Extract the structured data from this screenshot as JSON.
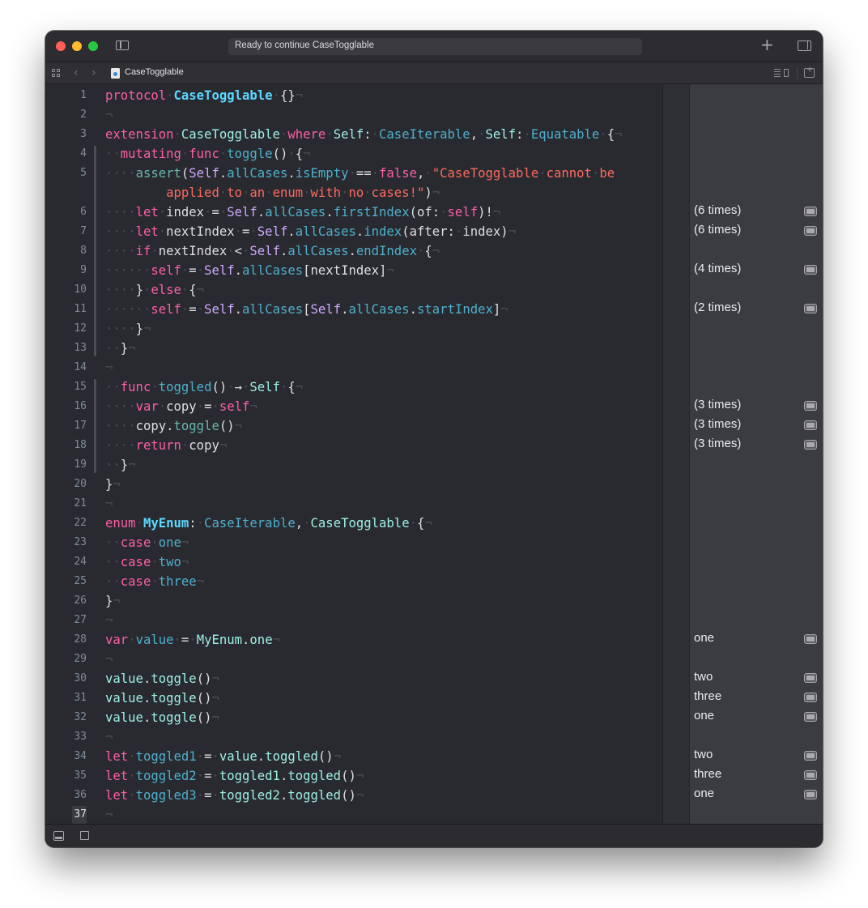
{
  "window": {
    "activity_text": "Ready to continue CaseTogglable",
    "file_name": "CaseTogglable"
  },
  "icons": [
    "sidebar-toggle-icon",
    "plus-icon",
    "inspector-toggle-icon",
    "grid-icon",
    "chevron-left-icon",
    "chevron-right-icon",
    "swift-file-icon",
    "editor-options-icon",
    "add-editor-icon",
    "console-toggle-icon",
    "stop-icon",
    "quick-look-icon"
  ],
  "lines": [
    {
      "n": "1",
      "html": "<span class=kw>protocol</span><span class=ws>·</span><span class=typ>CaseTogglable</span><span class=ws>·</span>{}<span class=ws>¬</span>"
    },
    {
      "n": "2",
      "html": "<span class=ws>¬</span>"
    },
    {
      "n": "3",
      "html": "<span class=kw>extension</span><span class=ws>·</span><span class=prj>CaseTogglable</span><span class=ws>·</span><span class=kw>where</span><span class=ws>·</span><span class=prj>Self</span>:<span class=ws>·</span><span class=cls>CaseIterable</span>,<span class=ws>·</span><span class=prj>Self</span>:<span class=ws>·</span><span class=cls>Equatable</span><span class=ws>·</span>{<span class=ws>¬</span>"
    },
    {
      "n": "4",
      "html": "<span class=ws>··</span><span class=kw>mutating</span><span class=ws>·</span><span class=kw>func</span><span class=ws>·</span><span class=cls>toggle</span>()<span class=ws>·</span>{<span class=ws>¬</span>"
    },
    {
      "n": "5",
      "html": "<span class=ws>····</span><span class=fn>assert</span>(<span class=swftp>Self</span>.<span class=cls>allCases</span>.<span class=cls>isEmpty</span><span class=ws>·</span>==<span class=ws>·</span><span class=kw>false</span>,<span class=ws>·</span><span class=str>\"CaseTogglable</span><span class=ws>·</span><span class=str>cannot</span><span class=ws>·</span><span class=str>be</span>"
    },
    {
      "n": "",
      "html": "<span class=ws>        </span><span class=str>applied</span><span class=ws>·</span><span class=str>to</span><span class=ws>·</span><span class=str>an</span><span class=ws>·</span><span class=str>enum</span><span class=ws>·</span><span class=str>with</span><span class=ws>·</span><span class=str>no</span><span class=ws>·</span><span class=str>cases!\"</span>)<span class=ws>¬</span>"
    },
    {
      "n": "6",
      "html": "<span class=ws>····</span><span class=kw>let</span><span class=ws>·</span>index<span class=ws>·</span>=<span class=ws>·</span><span class=swftp>Self</span>.<span class=cls>allCases</span>.<span class=cls>firstIndex</span>(of:<span class=ws>·</span><span class=kw>self</span>)!<span class=ws>¬</span>"
    },
    {
      "n": "7",
      "html": "<span class=ws>····</span><span class=kw>let</span><span class=ws>·</span>nextIndex<span class=ws>·</span>=<span class=ws>·</span><span class=swftp>Self</span>.<span class=cls>allCases</span>.<span class=cls>index</span>(after:<span class=ws>·</span>index)<span class=ws>¬</span>"
    },
    {
      "n": "8",
      "html": "<span class=ws>····</span><span class=kw>if</span><span class=ws>·</span>nextIndex<span class=ws>·</span>&lt;<span class=ws>·</span><span class=swftp>Self</span>.<span class=cls>allCases</span>.<span class=cls>endIndex</span><span class=ws>·</span>{<span class=ws>¬</span>"
    },
    {
      "n": "9",
      "html": "<span class=ws>······</span><span class=kw>self</span><span class=ws>·</span>=<span class=ws>·</span><span class=swftp>Self</span>.<span class=cls>allCases</span>[nextIndex]<span class=ws>¬</span>"
    },
    {
      "n": "10",
      "html": "<span class=ws>····</span>}<span class=ws>·</span><span class=kw>else</span><span class=ws>·</span>{<span class=ws>¬</span>"
    },
    {
      "n": "11",
      "html": "<span class=ws>······</span><span class=kw>self</span><span class=ws>·</span>=<span class=ws>·</span><span class=swftp>Self</span>.<span class=cls>allCases</span>[<span class=swftp>Self</span>.<span class=cls>allCases</span>.<span class=cls>startIndex</span>]<span class=ws>¬</span>"
    },
    {
      "n": "12",
      "html": "<span class=ws>····</span>}<span class=ws>¬</span>"
    },
    {
      "n": "13",
      "html": "<span class=ws>··</span>}<span class=ws>¬</span>"
    },
    {
      "n": "14",
      "html": "<span class=ws>¬</span>"
    },
    {
      "n": "15",
      "html": "<span class=ws>··</span><span class=kw>func</span><span class=ws>·</span><span class=cls>toggled</span>()<span class=ws>·</span>→<span class=ws>·</span><span class=prj>Self</span><span class=ws>·</span>{<span class=ws>¬</span>"
    },
    {
      "n": "16",
      "html": "<span class=ws>····</span><span class=kw>var</span><span class=ws>·</span>copy<span class=ws>·</span>=<span class=ws>·</span><span class=kw>self</span><span class=ws>¬</span>"
    },
    {
      "n": "17",
      "html": "<span class=ws>····</span>copy.<span class=fn>toggle</span>()<span class=ws>¬</span>"
    },
    {
      "n": "18",
      "html": "<span class=ws>····</span><span class=kw>return</span><span class=ws>·</span>copy<span class=ws>¬</span>"
    },
    {
      "n": "19",
      "html": "<span class=ws>··</span>}<span class=ws>¬</span>"
    },
    {
      "n": "20",
      "html": "}<span class=ws>¬</span>"
    },
    {
      "n": "21",
      "html": "<span class=ws>¬</span>"
    },
    {
      "n": "22",
      "html": "<span class=kw>enum</span><span class=ws>·</span><span class=typ>MyEnum</span>:<span class=ws>·</span><span class=cls>CaseIterable</span>,<span class=ws>·</span><span class=prj>CaseTogglable</span><span class=ws>·</span>{<span class=ws>¬</span>"
    },
    {
      "n": "23",
      "html": "<span class=ws>··</span><span class=kw>case</span><span class=ws>·</span><span class=cls>one</span><span class=ws>¬</span>"
    },
    {
      "n": "24",
      "html": "<span class=ws>··</span><span class=kw>case</span><span class=ws>·</span><span class=cls>two</span><span class=ws>¬</span>"
    },
    {
      "n": "25",
      "html": "<span class=ws>··</span><span class=kw>case</span><span class=ws>·</span><span class=cls>three</span><span class=ws>¬</span>"
    },
    {
      "n": "26",
      "html": "}<span class=ws>¬</span>"
    },
    {
      "n": "27",
      "html": "<span class=ws>¬</span>"
    },
    {
      "n": "28",
      "html": "<span class=kw>var</span><span class=ws>·</span><span class=cls>value</span><span class=ws>·</span>=<span class=ws>·</span><span class=prj>MyEnum</span>.<span class=prj>one</span><span class=ws>¬</span>"
    },
    {
      "n": "29",
      "html": "<span class=ws>¬</span>"
    },
    {
      "n": "30",
      "html": "<span class=prj>value</span>.<span class=prj>toggle</span>()<span class=ws>¬</span>"
    },
    {
      "n": "31",
      "html": "<span class=prj>value</span>.<span class=prj>toggle</span>()<span class=ws>¬</span>"
    },
    {
      "n": "32",
      "html": "<span class=prj>value</span>.<span class=prj>toggle</span>()<span class=ws>¬</span>"
    },
    {
      "n": "33",
      "html": "<span class=ws>¬</span>"
    },
    {
      "n": "34",
      "html": "<span class=kw>let</span><span class=ws>·</span><span class=cls>toggled1</span><span class=ws>·</span>=<span class=ws>·</span><span class=prj>value</span>.<span class=prj>toggled</span>()<span class=ws>¬</span>"
    },
    {
      "n": "35",
      "html": "<span class=kw>let</span><span class=ws>·</span><span class=cls>toggled2</span><span class=ws>·</span>=<span class=ws>·</span><span class=prj>toggled1</span>.<span class=prj>toggled</span>()<span class=ws>¬</span>"
    },
    {
      "n": "36",
      "html": "<span class=kw>let</span><span class=ws>·</span><span class=cls>toggled3</span><span class=ws>·</span>=<span class=ws>·</span><span class=prj>toggled2</span>.<span class=prj>toggled</span>()<span class=ws>¬</span>"
    },
    {
      "n": "37",
      "html": "<span class=ws>¬</span>"
    }
  ],
  "results": [
    {
      "line": "6",
      "text": "(6 times)"
    },
    {
      "line": "7",
      "text": "(6 times)"
    },
    {
      "line": "9",
      "text": "(4 times)"
    },
    {
      "line": "11",
      "text": "(2 times)"
    },
    {
      "line": "16",
      "text": "(3 times)"
    },
    {
      "line": "17",
      "text": "(3 times)"
    },
    {
      "line": "18",
      "text": "(3 times)"
    },
    {
      "line": "28",
      "text": "one"
    },
    {
      "line": "30",
      "text": "two"
    },
    {
      "line": "31",
      "text": "three"
    },
    {
      "line": "32",
      "text": "one"
    },
    {
      "line": "34",
      "text": "two"
    },
    {
      "line": "35",
      "text": "three"
    },
    {
      "line": "36",
      "text": "one"
    }
  ],
  "current_line": "37"
}
